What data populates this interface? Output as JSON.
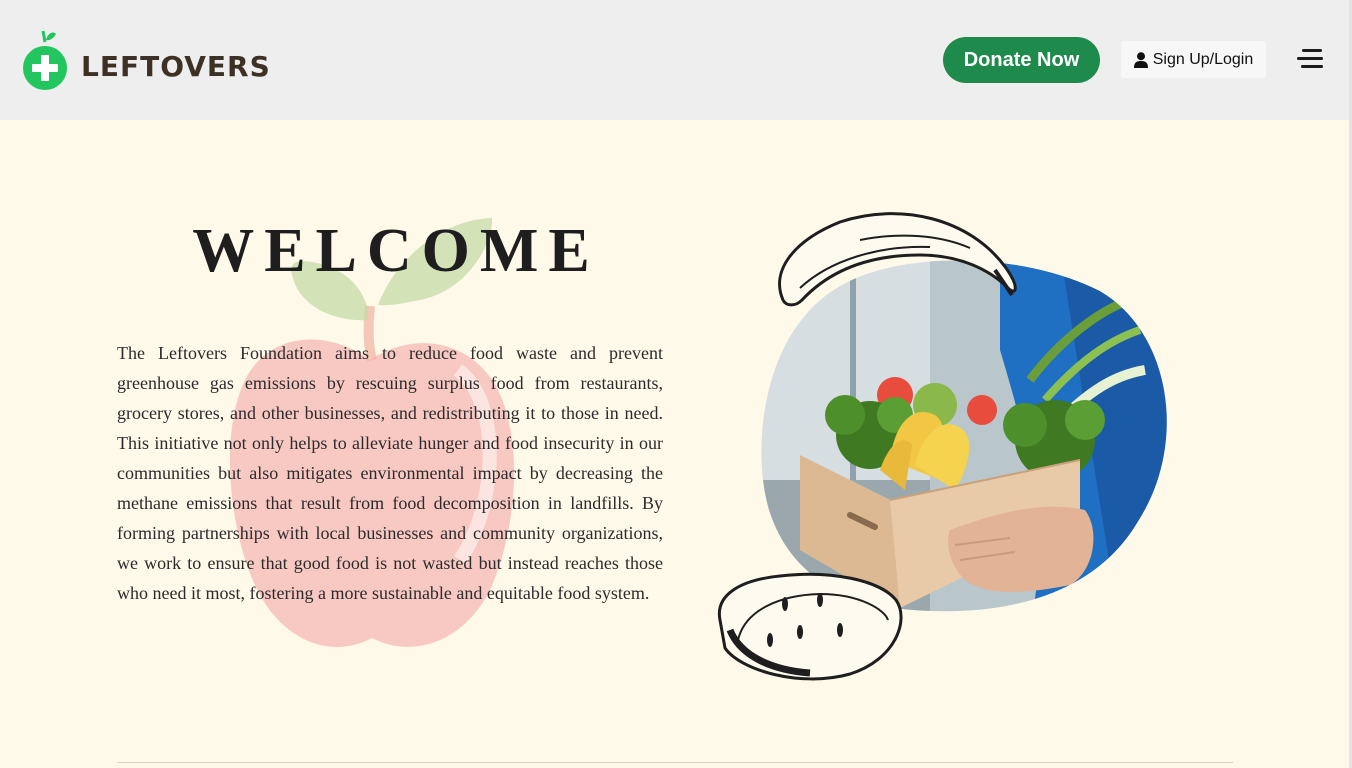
{
  "header": {
    "logo_text": "LEFTOVERS",
    "donate_label": "Donate Now",
    "signup_label": "Sign Up/Login",
    "icons": [
      "leftovers-logo-icon",
      "user-icon",
      "hamburger-menu-icon"
    ]
  },
  "main": {
    "title": "WELCOME",
    "intro": "The Leftovers Foundation aims to reduce food waste and prevent greenhouse gas emissions by rescuing surplus food from restaurants, grocery stores, and other businesses, and redistributing it to those in need. This initiative not only helps to alleviate hunger and food insecurity in our communities but also mitigates environmental impact by decreasing the methane emissions that result from food decomposition in landfills. By forming partnerships with local businesses and community organizations, we work to ensure that good food is not wasted but instead reaches those who need it most, fostering a more sustainable and equitable food system."
  },
  "colors": {
    "header_bg": "#eeeeee",
    "page_bg": "#fff9ea",
    "brand_green": "#1e8a4c",
    "logo_green": "#22c55e",
    "logo_text": "#3d3126"
  }
}
